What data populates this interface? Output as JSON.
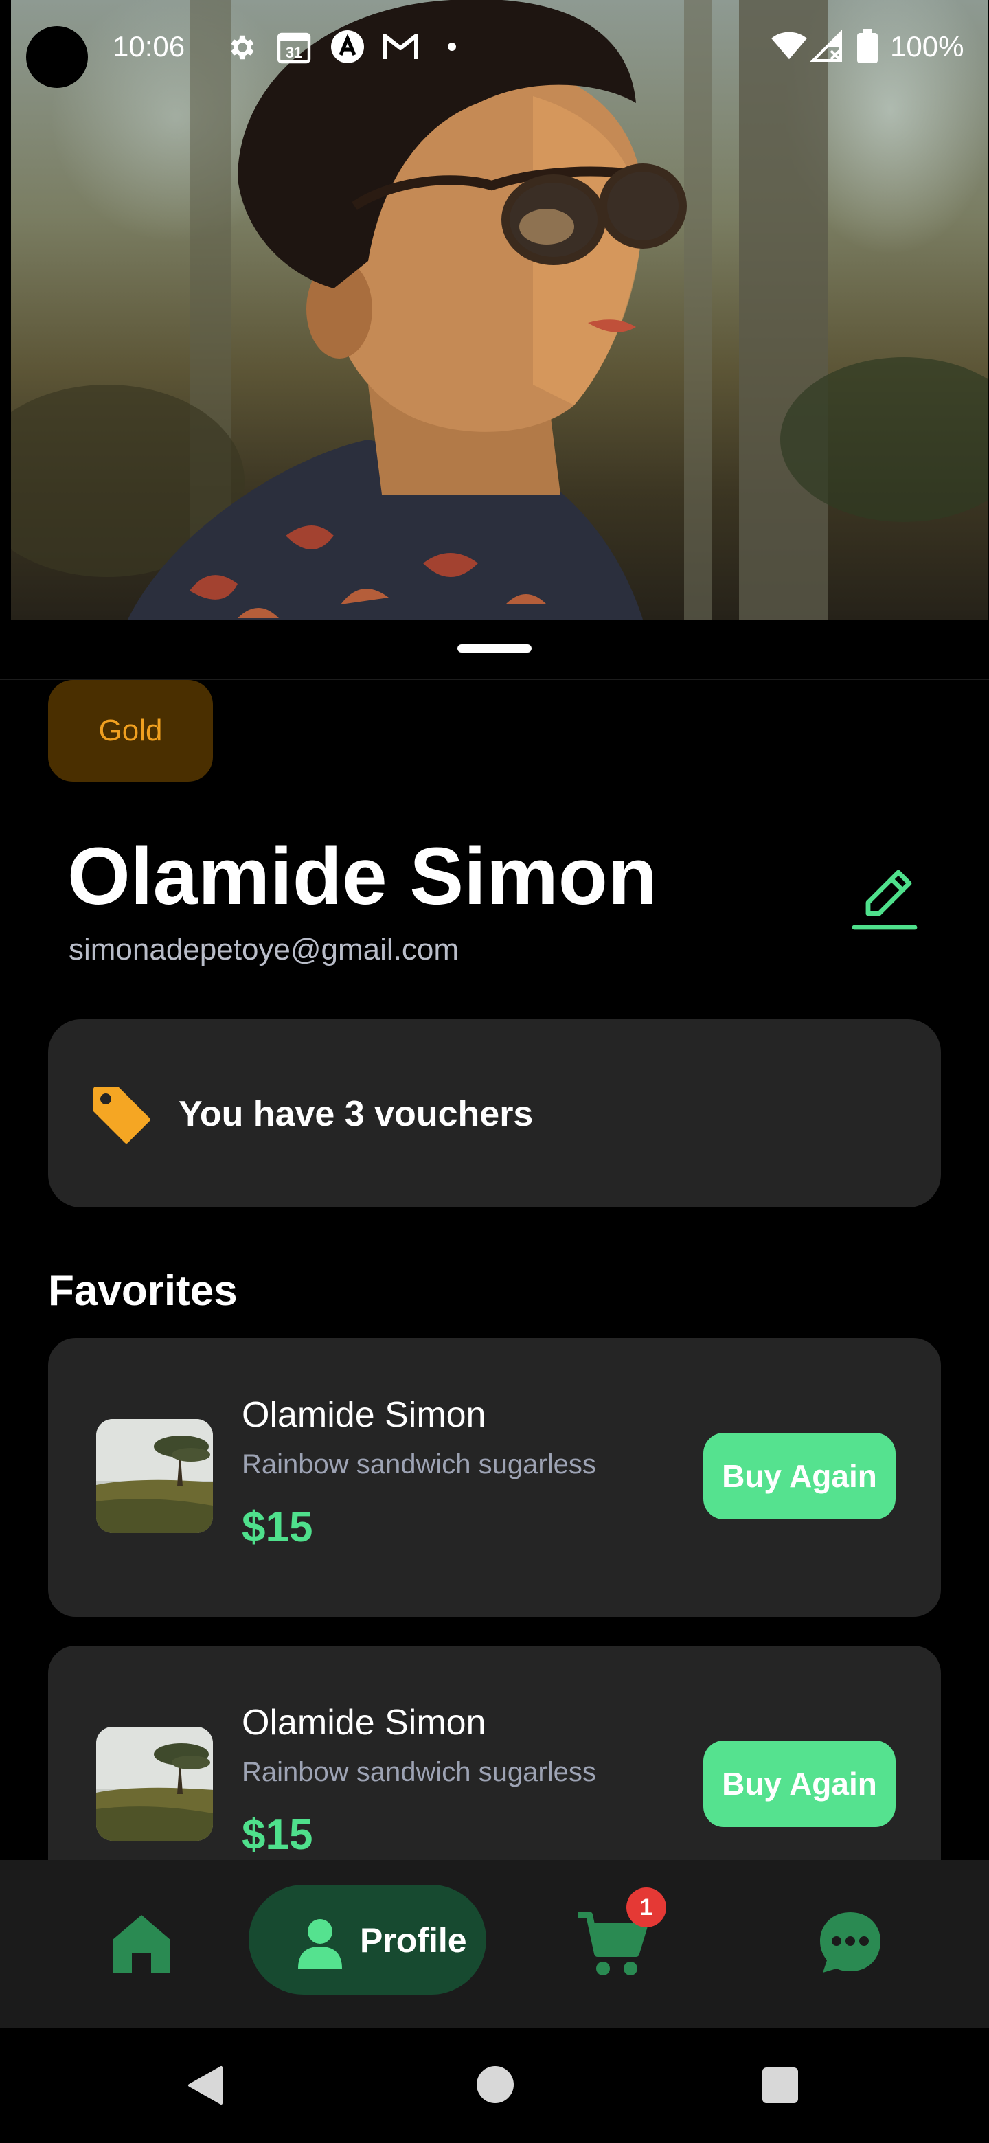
{
  "status_bar": {
    "time": "10:06",
    "battery": "100%",
    "icons": [
      "settings-gear-icon",
      "calendar-icon",
      "app-a-icon",
      "gmail-icon",
      "notification-dot-icon",
      "wifi-icon",
      "signal-icon",
      "battery-icon"
    ],
    "calendar_day": "31"
  },
  "profile": {
    "tier_badge": "Gold",
    "name": "Olamide Simon",
    "email": "simonadepetoye@gmail.com",
    "edit_icon": "pencil-edit-icon"
  },
  "voucher": {
    "icon": "tag-icon",
    "text": "You have 3 vouchers"
  },
  "favorites": {
    "title": "Favorites",
    "items": [
      {
        "name": "Olamide Simon",
        "description": "Rainbow sandwich sugarless",
        "price": "$15",
        "button": "Buy Again"
      },
      {
        "name": "Olamide Simon",
        "description": "Rainbow sandwich sugarless",
        "price": "$15",
        "button": "Buy Again"
      }
    ]
  },
  "bottom_nav": {
    "items": [
      {
        "icon": "home-icon",
        "label": ""
      },
      {
        "icon": "person-icon",
        "label": "Profile",
        "active": true
      },
      {
        "icon": "cart-icon",
        "label": "",
        "badge": "1"
      },
      {
        "icon": "chat-icon",
        "label": ""
      }
    ]
  },
  "colors": {
    "accent_green": "#55e28f",
    "tier_gold": "#f0a020",
    "card_bg": "#252525",
    "background": "#000000"
  }
}
